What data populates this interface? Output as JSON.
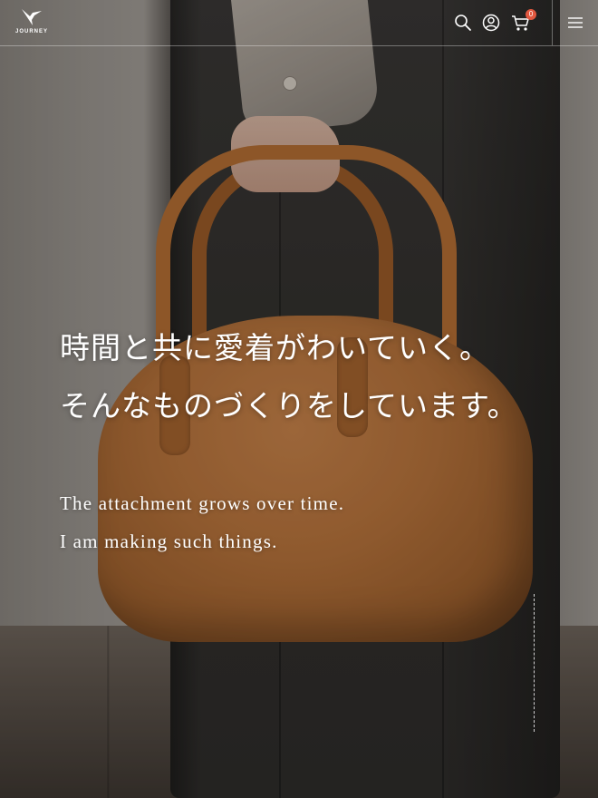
{
  "header": {
    "logo_text": "JOURNEY",
    "cart_count": "0",
    "icons": [
      "search-icon",
      "account-icon",
      "cart-icon",
      "menu-icon"
    ]
  },
  "hero": {
    "headline_lines": [
      "時間と共に愛着がわいていく。",
      "そんなものづくりをしています。"
    ],
    "subcopy_lines": [
      "The attachment grows over time.",
      "I am making such things."
    ]
  },
  "colors": {
    "text": "#ffffff",
    "badge": "#e2573f",
    "leather": "#b8743c"
  }
}
